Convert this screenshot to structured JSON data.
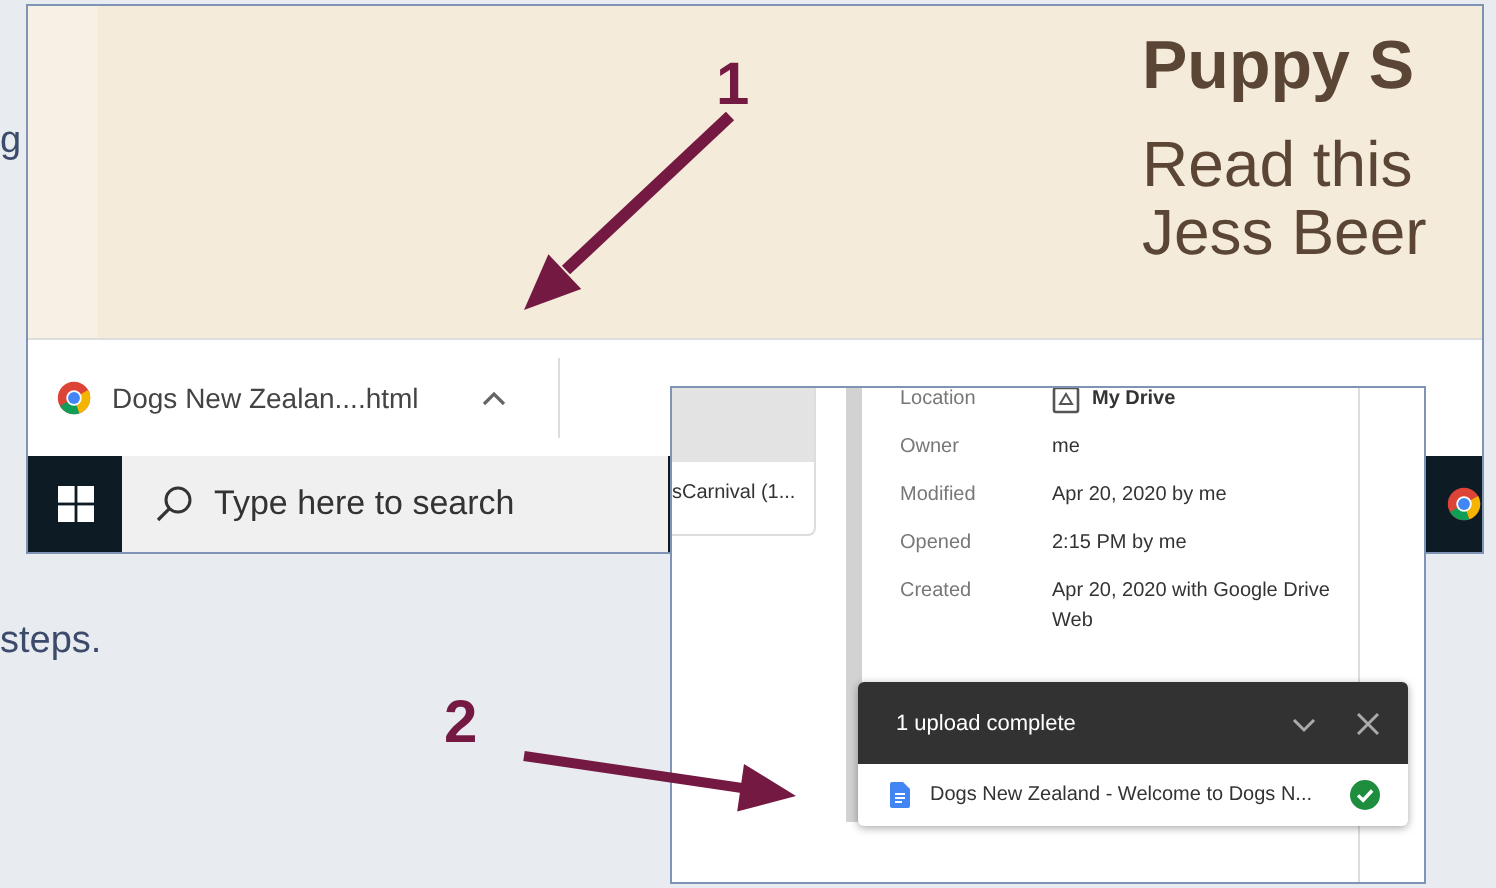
{
  "background": {
    "text_fragments": [
      "g",
      "steps."
    ]
  },
  "web_page": {
    "heading": "Puppy S",
    "lines": [
      "Read this",
      "Jess Beer"
    ]
  },
  "download_bar": {
    "items": [
      {
        "filename": "Dogs New Zealan....html"
      }
    ]
  },
  "taskbar": {
    "search": {
      "placeholder": "Type here to search"
    }
  },
  "drive": {
    "file_card": {
      "name": "sCarnival (1..."
    },
    "details": [
      {
        "label": "Location",
        "value": "My Drive",
        "kind": "location"
      },
      {
        "label": "Owner",
        "value": "me",
        "kind": "text"
      },
      {
        "label": "Modified",
        "value": "Apr 20, 2020 by me",
        "kind": "text"
      },
      {
        "label": "Opened",
        "value": "2:15 PM by me",
        "kind": "text"
      },
      {
        "label": "Created",
        "value": "Apr 20, 2020 with Google Drive Web",
        "kind": "text"
      }
    ],
    "upload_toast": {
      "title": "1 upload complete",
      "items": [
        {
          "name": "Dogs New Zealand - Welcome to Dogs N...",
          "done": true
        }
      ]
    }
  },
  "callouts": [
    {
      "label": "1"
    },
    {
      "label": "2"
    }
  ]
}
